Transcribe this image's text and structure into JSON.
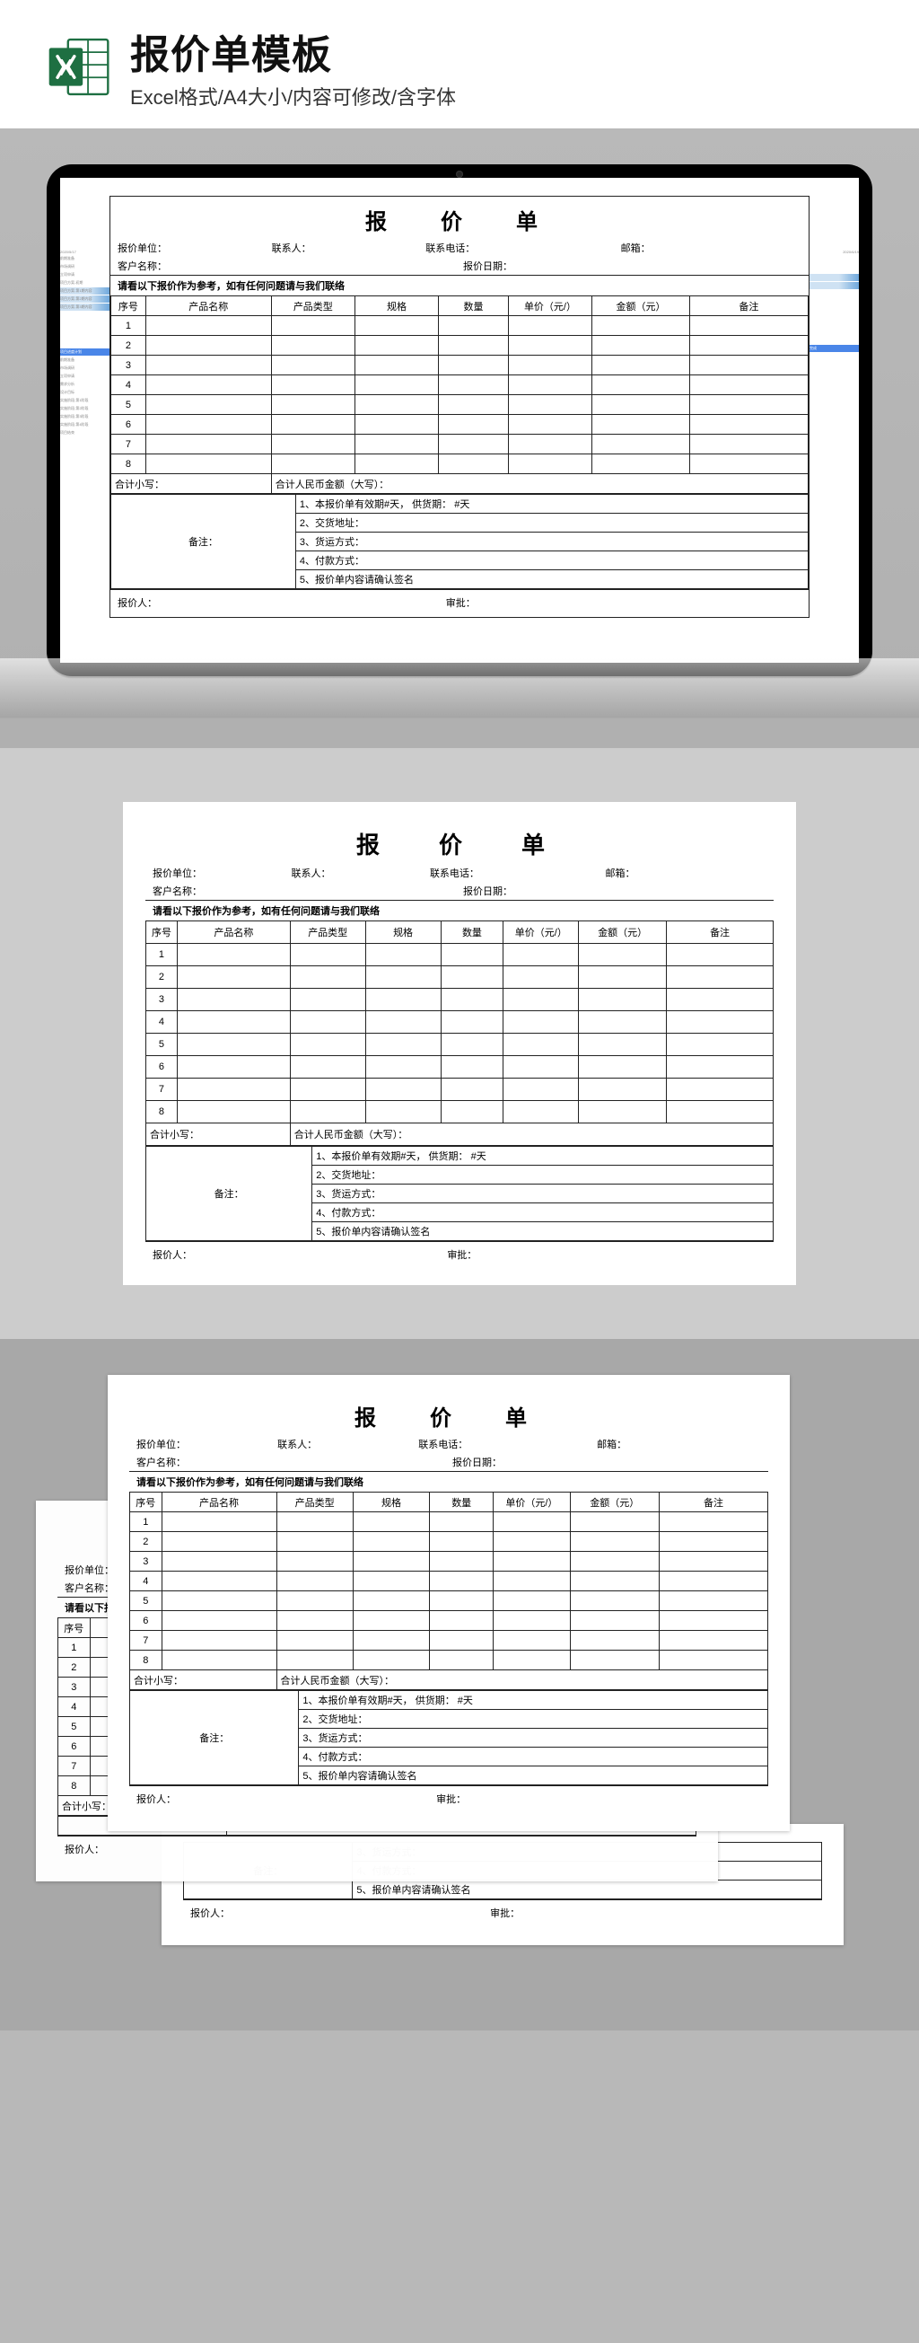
{
  "header": {
    "title": "报价单模板",
    "subtitle": "Excel格式/A4大小/内容可修改/含字体"
  },
  "sheet": {
    "title": "报　价　单",
    "row1": {
      "unit_label": "报价单位：",
      "contact_label": "联系人：",
      "phone_label": "联系电话：",
      "email_label": "邮箱："
    },
    "row2": {
      "client_label": "客户名称：",
      "date_label": "报价日期："
    },
    "instruction": "请看以下报价作为参考，如有任何问题请与我们联络",
    "cols": {
      "seq": "序号",
      "name": "产品名称",
      "type": "产品类型",
      "spec": "规格",
      "qty": "数量",
      "price": "单价（元/）",
      "amt": "金额（元）",
      "note": "备注"
    },
    "rows": [
      "1",
      "2",
      "3",
      "4",
      "5",
      "6",
      "7",
      "8"
    ],
    "sum_label": "合计小写：",
    "sum_cap_label": "合计人民币金额（大写）：",
    "remark_label": "备注：",
    "notes": {
      "n1": "1、本报价单有效期#天，    供货期：    #天",
      "n2": "2、交货地址：",
      "n3": "3、货运方式：",
      "n4": "4、付款方式：",
      "n5": "5、报价单内容请确认签名"
    },
    "footer": {
      "quoter": "报价人：",
      "approver": "审批："
    }
  },
  "gantt_left": {
    "date": "2020/5/17",
    "items": [
      "前期准备",
      "市场调研",
      "立项申请",
      "项目方案-初期",
      "项目方案-第1期内容",
      "项目方案-第2期内容",
      "项目方案-第3期内容"
    ],
    "hdr": "项目进度计划",
    "items2": [
      "前期准备",
      "市场调研",
      "立项申请",
      "需求分析",
      "设计目标",
      "实施阶段-第1阶段",
      "实施阶段-第2阶段",
      "实施阶段-第3阶段",
      "实施阶段-第4阶段",
      "项目结束"
    ]
  },
  "gantt_right": {
    "date": "2020/6/19",
    "col": "完成"
  }
}
